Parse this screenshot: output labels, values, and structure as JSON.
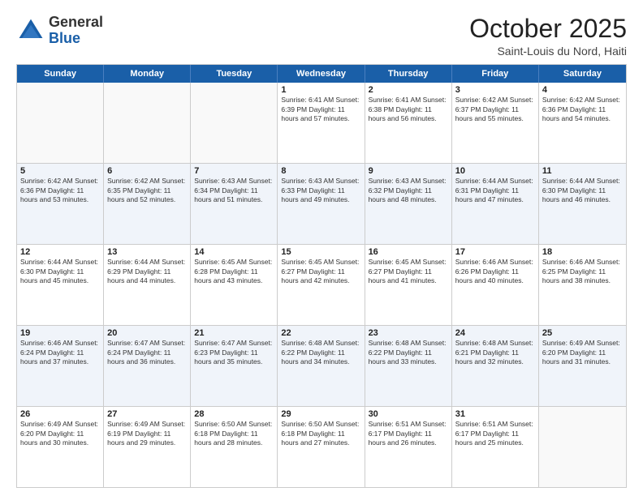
{
  "header": {
    "logo_general": "General",
    "logo_blue": "Blue",
    "month": "October 2025",
    "location": "Saint-Louis du Nord, Haiti"
  },
  "days_of_week": [
    "Sunday",
    "Monday",
    "Tuesday",
    "Wednesday",
    "Thursday",
    "Friday",
    "Saturday"
  ],
  "rows": [
    [
      {
        "day": "",
        "text": "",
        "empty": true
      },
      {
        "day": "",
        "text": "",
        "empty": true
      },
      {
        "day": "",
        "text": "",
        "empty": true
      },
      {
        "day": "1",
        "text": "Sunrise: 6:41 AM\nSunset: 6:39 PM\nDaylight: 11 hours and 57 minutes."
      },
      {
        "day": "2",
        "text": "Sunrise: 6:41 AM\nSunset: 6:38 PM\nDaylight: 11 hours and 56 minutes."
      },
      {
        "day": "3",
        "text": "Sunrise: 6:42 AM\nSunset: 6:37 PM\nDaylight: 11 hours and 55 minutes."
      },
      {
        "day": "4",
        "text": "Sunrise: 6:42 AM\nSunset: 6:36 PM\nDaylight: 11 hours and 54 minutes."
      }
    ],
    [
      {
        "day": "5",
        "text": "Sunrise: 6:42 AM\nSunset: 6:36 PM\nDaylight: 11 hours and 53 minutes."
      },
      {
        "day": "6",
        "text": "Sunrise: 6:42 AM\nSunset: 6:35 PM\nDaylight: 11 hours and 52 minutes."
      },
      {
        "day": "7",
        "text": "Sunrise: 6:43 AM\nSunset: 6:34 PM\nDaylight: 11 hours and 51 minutes."
      },
      {
        "day": "8",
        "text": "Sunrise: 6:43 AM\nSunset: 6:33 PM\nDaylight: 11 hours and 49 minutes."
      },
      {
        "day": "9",
        "text": "Sunrise: 6:43 AM\nSunset: 6:32 PM\nDaylight: 11 hours and 48 minutes."
      },
      {
        "day": "10",
        "text": "Sunrise: 6:44 AM\nSunset: 6:31 PM\nDaylight: 11 hours and 47 minutes."
      },
      {
        "day": "11",
        "text": "Sunrise: 6:44 AM\nSunset: 6:30 PM\nDaylight: 11 hours and 46 minutes."
      }
    ],
    [
      {
        "day": "12",
        "text": "Sunrise: 6:44 AM\nSunset: 6:30 PM\nDaylight: 11 hours and 45 minutes."
      },
      {
        "day": "13",
        "text": "Sunrise: 6:44 AM\nSunset: 6:29 PM\nDaylight: 11 hours and 44 minutes."
      },
      {
        "day": "14",
        "text": "Sunrise: 6:45 AM\nSunset: 6:28 PM\nDaylight: 11 hours and 43 minutes."
      },
      {
        "day": "15",
        "text": "Sunrise: 6:45 AM\nSunset: 6:27 PM\nDaylight: 11 hours and 42 minutes."
      },
      {
        "day": "16",
        "text": "Sunrise: 6:45 AM\nSunset: 6:27 PM\nDaylight: 11 hours and 41 minutes."
      },
      {
        "day": "17",
        "text": "Sunrise: 6:46 AM\nSunset: 6:26 PM\nDaylight: 11 hours and 40 minutes."
      },
      {
        "day": "18",
        "text": "Sunrise: 6:46 AM\nSunset: 6:25 PM\nDaylight: 11 hours and 38 minutes."
      }
    ],
    [
      {
        "day": "19",
        "text": "Sunrise: 6:46 AM\nSunset: 6:24 PM\nDaylight: 11 hours and 37 minutes."
      },
      {
        "day": "20",
        "text": "Sunrise: 6:47 AM\nSunset: 6:24 PM\nDaylight: 11 hours and 36 minutes."
      },
      {
        "day": "21",
        "text": "Sunrise: 6:47 AM\nSunset: 6:23 PM\nDaylight: 11 hours and 35 minutes."
      },
      {
        "day": "22",
        "text": "Sunrise: 6:48 AM\nSunset: 6:22 PM\nDaylight: 11 hours and 34 minutes."
      },
      {
        "day": "23",
        "text": "Sunrise: 6:48 AM\nSunset: 6:22 PM\nDaylight: 11 hours and 33 minutes."
      },
      {
        "day": "24",
        "text": "Sunrise: 6:48 AM\nSunset: 6:21 PM\nDaylight: 11 hours and 32 minutes."
      },
      {
        "day": "25",
        "text": "Sunrise: 6:49 AM\nSunset: 6:20 PM\nDaylight: 11 hours and 31 minutes."
      }
    ],
    [
      {
        "day": "26",
        "text": "Sunrise: 6:49 AM\nSunset: 6:20 PM\nDaylight: 11 hours and 30 minutes."
      },
      {
        "day": "27",
        "text": "Sunrise: 6:49 AM\nSunset: 6:19 PM\nDaylight: 11 hours and 29 minutes."
      },
      {
        "day": "28",
        "text": "Sunrise: 6:50 AM\nSunset: 6:18 PM\nDaylight: 11 hours and 28 minutes."
      },
      {
        "day": "29",
        "text": "Sunrise: 6:50 AM\nSunset: 6:18 PM\nDaylight: 11 hours and 27 minutes."
      },
      {
        "day": "30",
        "text": "Sunrise: 6:51 AM\nSunset: 6:17 PM\nDaylight: 11 hours and 26 minutes."
      },
      {
        "day": "31",
        "text": "Sunrise: 6:51 AM\nSunset: 6:17 PM\nDaylight: 11 hours and 25 minutes."
      },
      {
        "day": "",
        "text": "",
        "empty": true
      }
    ]
  ]
}
